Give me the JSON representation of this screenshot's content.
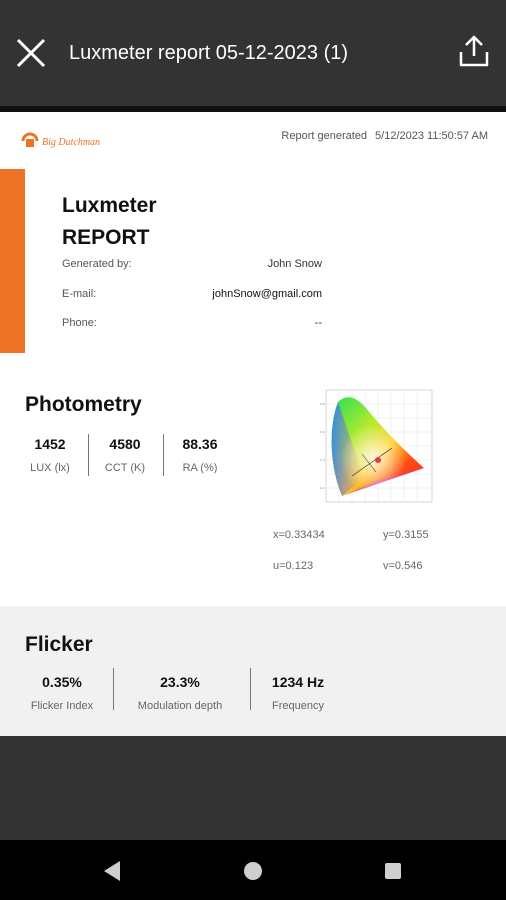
{
  "toolbar": {
    "title": "Luxmeter report 05-12-2023 (1)",
    "close_icon": "close-icon",
    "share_icon": "share-upload-icon"
  },
  "report": {
    "logo_text": "Big Dutchman",
    "generated_label": "Report generated",
    "generated_value": "5/12/2023 11:50:57 AM",
    "title_line1": "Luxmeter",
    "title_line2": "REPORT",
    "fields": [
      {
        "label": "Generated by:",
        "value": "John  Snow"
      },
      {
        "label": "E-mail:",
        "value": "johnSnow@gmail.com"
      },
      {
        "label": "Phone:",
        "value": "--"
      }
    ],
    "photometry": {
      "title": "Photometry",
      "metrics": [
        {
          "value": "1452",
          "label": "LUX (lx)"
        },
        {
          "value": "4580",
          "label": "CCT (K)"
        },
        {
          "value": "88.36",
          "label": "RA (%)"
        }
      ],
      "coords": {
        "x": "x=0.33434",
        "y": "y=0.3155",
        "u": "u=0.123",
        "v": "v=0.546"
      }
    },
    "flicker": {
      "title": "Flicker",
      "metrics": [
        {
          "value": "0.35%",
          "label": "Flicker Index"
        },
        {
          "value": "23.3%",
          "label": "Modulation depth"
        },
        {
          "value": "1234 Hz",
          "label": "Frequency"
        }
      ]
    }
  },
  "navbar": {
    "back_icon": "back-triangle-icon",
    "home_icon": "home-circle-icon",
    "recents_icon": "recents-square-icon"
  },
  "colors": {
    "accent_orange": "#EE7326",
    "toolbar_bg": "#333333",
    "flicker_bg": "#F1F1F1"
  }
}
